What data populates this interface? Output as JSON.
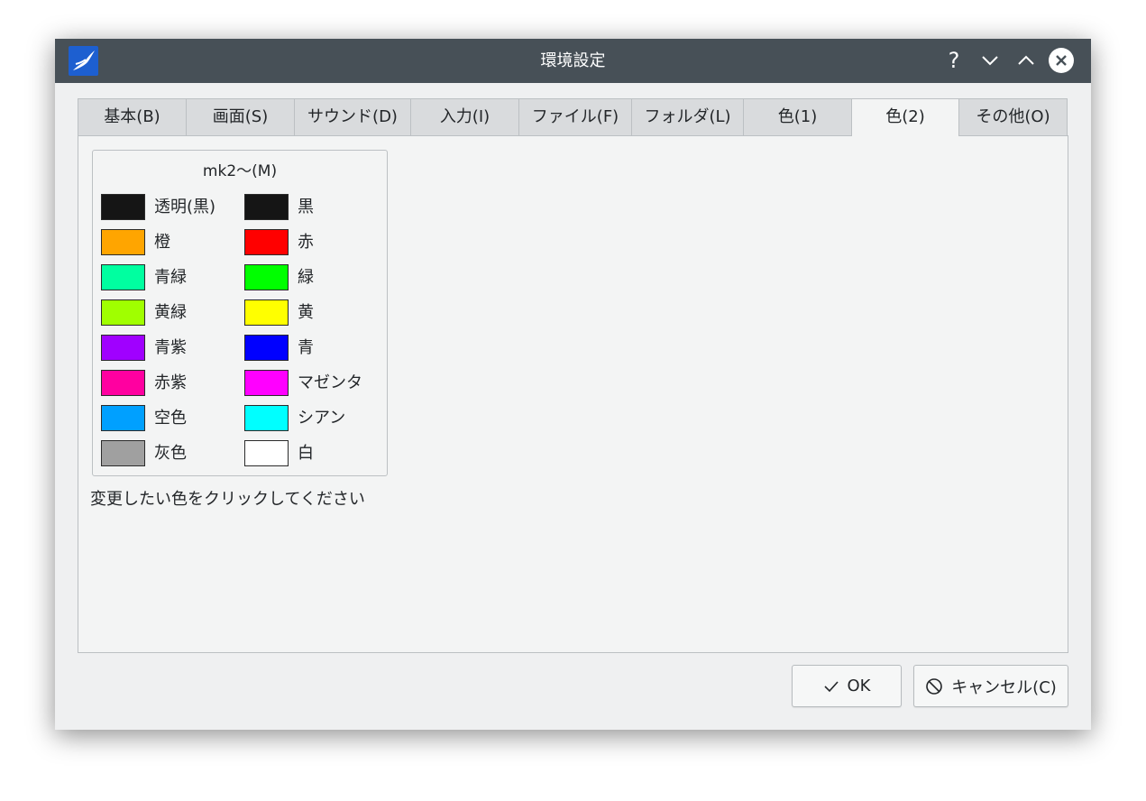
{
  "window": {
    "title": "環境設定",
    "help_glyph": "?"
  },
  "tabs": [
    {
      "label": "基本(B)",
      "active": false
    },
    {
      "label": "画面(S)",
      "active": false
    },
    {
      "label": "サウンド(D)",
      "active": false
    },
    {
      "label": "入力(I)",
      "active": false
    },
    {
      "label": "ファイル(F)",
      "active": false
    },
    {
      "label": "フォルダ(L)",
      "active": false
    },
    {
      "label": "色(1)",
      "active": false
    },
    {
      "label": "色(2)",
      "active": true
    },
    {
      "label": "その他(O)",
      "active": false
    }
  ],
  "group": {
    "title": "mk2〜(M)",
    "colors": [
      {
        "label": "透明(黒)",
        "color": "#151515"
      },
      {
        "label": "黒",
        "color": "#151515"
      },
      {
        "label": "橙",
        "color": "#ffa500"
      },
      {
        "label": "赤",
        "color": "#ff0000"
      },
      {
        "label": "青緑",
        "color": "#00ffa0"
      },
      {
        "label": "緑",
        "color": "#00ff00"
      },
      {
        "label": "黄緑",
        "color": "#a0ff00"
      },
      {
        "label": "黄",
        "color": "#ffff00"
      },
      {
        "label": "青紫",
        "color": "#a000ff"
      },
      {
        "label": "青",
        "color": "#0000ff"
      },
      {
        "label": "赤紫",
        "color": "#ff00a0"
      },
      {
        "label": "マゼンタ",
        "color": "#ff00ff"
      },
      {
        "label": "空色",
        "color": "#00a0ff"
      },
      {
        "label": "シアン",
        "color": "#00ffff"
      },
      {
        "label": "灰色",
        "color": "#a0a0a0"
      },
      {
        "label": "白",
        "color": "#ffffff"
      }
    ]
  },
  "hint": "変更したい色をクリックしてください",
  "buttons": {
    "ok_label": "OK",
    "cancel_label": "キャンセル(C)"
  }
}
